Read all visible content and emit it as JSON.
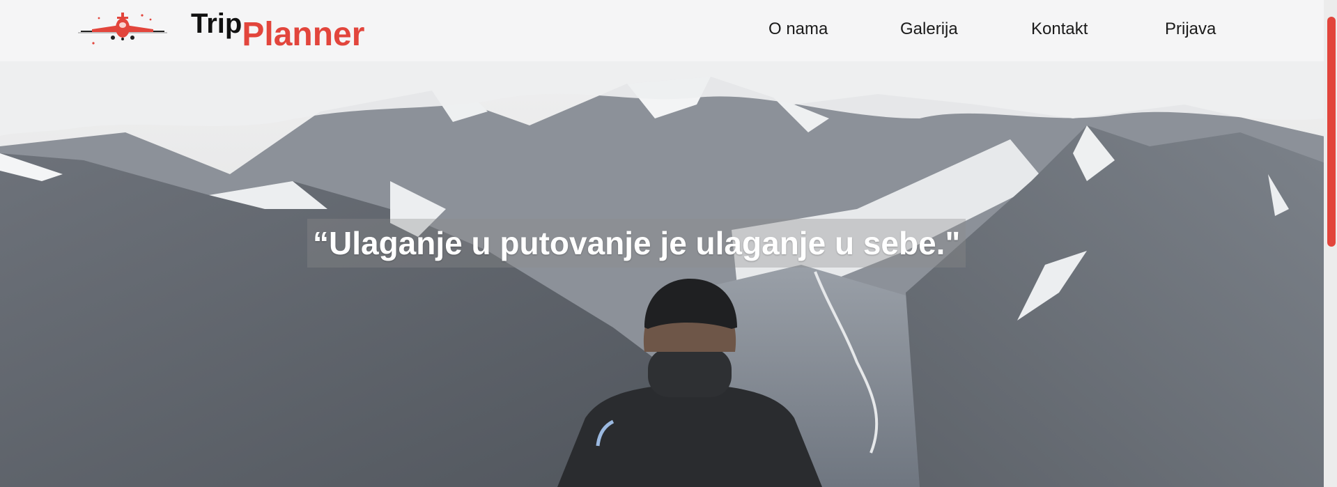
{
  "header": {
    "brand_trip": "Trip",
    "brand_planner": "Planner",
    "nav": [
      {
        "label": "O nama"
      },
      {
        "label": "Galerija"
      },
      {
        "label": "Kontakt"
      },
      {
        "label": "Prijava"
      }
    ]
  },
  "hero": {
    "quote": "“Ulaganje u putovanje je ulaganje u sebe.\""
  },
  "colors": {
    "accent": "#e2453c",
    "header_bg": "#f5f5f6",
    "text_dark": "#111111"
  },
  "icons": {
    "logo": "airplane-icon"
  }
}
